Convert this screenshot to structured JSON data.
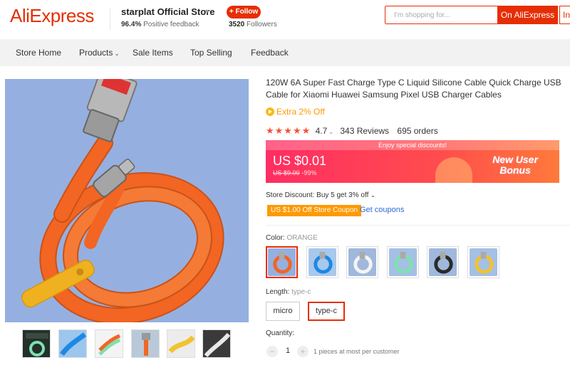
{
  "header": {
    "logo": "AliExpress",
    "store_name": "starplat Official Store",
    "positive_pct": "96.4%",
    "positive_text": "Positive feedback",
    "follow_label": "+ Follow",
    "followers_count": "3520",
    "followers_text": "Followers",
    "search_placeholder": "I'm shopping for...",
    "search_on_label": "On AliExpress",
    "search_in_label": "In"
  },
  "nav": {
    "items": [
      "Store Home",
      "Products",
      "Sale Items",
      "Top Selling",
      "Feedback"
    ]
  },
  "product": {
    "title": "120W 6A Super Fast Charge Type C Liquid Silicone Cable Quick Charge USB Cable for Xiaomi Huawei Samsung Pixel USB Charger Cables",
    "extra_off": "Extra 2% Off",
    "rating": "4.7",
    "stars": 5,
    "reviews": "343 Reviews",
    "orders": "695 orders",
    "banner_top": "Enjoy special discounts!",
    "price": "US $0.01",
    "old_price": "US $9.00",
    "discount_pct": "-99%",
    "new_user_line1": "New User",
    "new_user_line2": "Bonus",
    "store_discount": "Store Discount: Buy 5 get 3% off",
    "coupon_tag": "US $1.00 Off Store Coupon",
    "get_coupons": "Get coupons",
    "color_label": "Color:",
    "color_value": "ORANGE",
    "color_options": [
      "orange",
      "blue",
      "white",
      "green",
      "black",
      "yellow"
    ],
    "length_label": "Length:",
    "length_value": "type-c",
    "length_options": [
      "micro",
      "type-c"
    ],
    "quantity_label": "Quantity:",
    "quantity_value": "1",
    "quantity_note": "1 pieces at most per customer"
  },
  "colors": {
    "accent": "#e62e04",
    "cable_orange": "#f26522",
    "cable_blue": "#1e88e5",
    "cable_white": "#f4f4f4",
    "cable_green": "#7fe0b0",
    "cable_black": "#2a2a2a",
    "cable_yellow": "#f2c230"
  }
}
